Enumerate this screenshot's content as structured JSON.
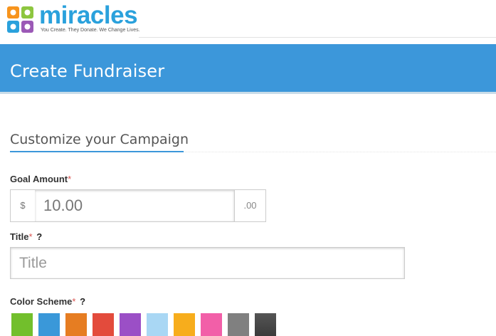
{
  "brand": {
    "name": "miracles",
    "tagline": "You Create. They Donate. We Change Lives.",
    "logo_colors": [
      "#f7941d",
      "#8dc63f",
      "#2aa1dc",
      "#9b59b6"
    ]
  },
  "banner": {
    "title": "Create Fundraiser",
    "color": "#3c97da"
  },
  "section": {
    "title": "Customize your Campaign"
  },
  "goal": {
    "label": "Goal Amount",
    "required_mark": "*",
    "currency_prefix": "$",
    "value": "10.00",
    "suffix": ".00"
  },
  "title_field": {
    "label": "Title",
    "required_mark": "*",
    "help": "?",
    "placeholder": "Title"
  },
  "color_scheme": {
    "label": "Color Scheme",
    "required_mark": "*",
    "help": "?",
    "swatches": [
      "#72bf2c",
      "#3a98d9",
      "#e67d22",
      "#e34b3c",
      "#9b4fc6",
      "#a9d7f4",
      "#f7ad1c",
      "#f25fa8",
      "#808080",
      "#3b3b3b"
    ]
  }
}
